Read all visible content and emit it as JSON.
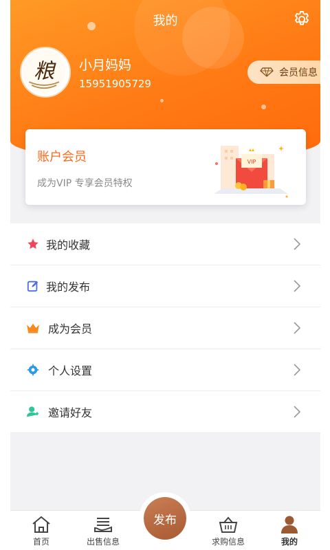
{
  "header": {
    "title": "我的",
    "username": "小月妈妈",
    "phone": "15951905729",
    "member_info_label": "会员信息",
    "avatar_char": "粮"
  },
  "vip_card": {
    "title": "账户会员",
    "subtitle": "成为VIP  专享会员特权",
    "badge": "VIP"
  },
  "menu": {
    "items": [
      {
        "label": "我的收藏",
        "icon": "star-icon"
      },
      {
        "label": "我的发布",
        "icon": "edit-icon"
      },
      {
        "label": "成为会员",
        "icon": "crown-icon"
      },
      {
        "label": "个人设置",
        "icon": "gear-icon"
      },
      {
        "label": "邀请好友",
        "icon": "person-add-icon"
      }
    ]
  },
  "tabbar": {
    "home": "首页",
    "sell": "出售信息",
    "publish": "发布",
    "buy": "求购信息",
    "mine": "我的"
  },
  "colors": {
    "accent": "#ff7a14",
    "publish": "#b3683f"
  }
}
